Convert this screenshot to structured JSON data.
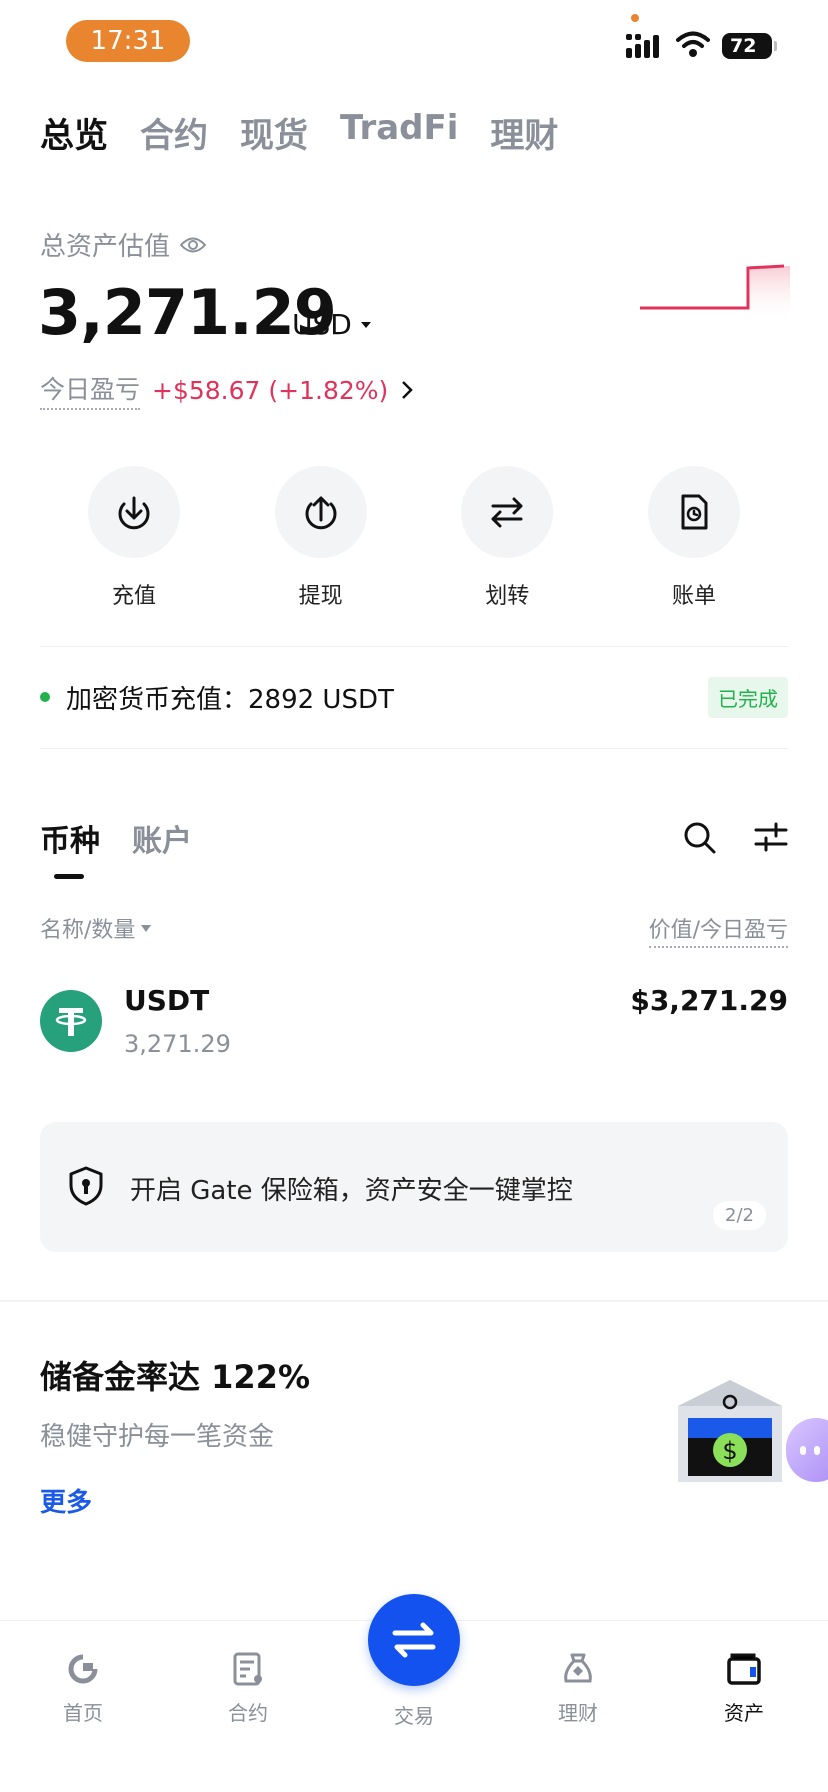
{
  "status_bar": {
    "time": "17:31",
    "battery": "72"
  },
  "top_tabs": [
    {
      "label": "总览",
      "active": true
    },
    {
      "label": "合约",
      "active": false
    },
    {
      "label": "现货",
      "active": false
    },
    {
      "label": "TradFi",
      "active": false
    },
    {
      "label": "理财",
      "active": false
    }
  ],
  "summary": {
    "label": "总资产估值",
    "value": "3,271.29",
    "currency": "USD",
    "pnl_label": "今日盈亏",
    "pnl_value": "+$58.67 (+1.82%)"
  },
  "actions": [
    {
      "label": "充值",
      "icon": "deposit-icon"
    },
    {
      "label": "提现",
      "icon": "withdraw-icon"
    },
    {
      "label": "划转",
      "icon": "transfer-icon"
    },
    {
      "label": "账单",
      "icon": "bill-icon"
    }
  ],
  "notice": {
    "text": "加密货币充值：2892 USDT",
    "badge": "已完成"
  },
  "asset_tabs": [
    {
      "label": "币种",
      "active": true
    },
    {
      "label": "账户",
      "active": false
    }
  ],
  "columns": {
    "left": "名称/数量",
    "right": "价值/今日盈亏"
  },
  "coins": [
    {
      "name": "USDT",
      "amount": "3,271.29",
      "value": "$3,271.29"
    }
  ],
  "promo": {
    "text": "开启 Gate 保险箱，资产安全一键掌控",
    "page": "2/2"
  },
  "reserve": {
    "title": "储备金率达 122%",
    "subtitle": "稳健守护每一笔资金",
    "more": "更多"
  },
  "bottom_nav": [
    {
      "label": "首页",
      "icon": "home-icon"
    },
    {
      "label": "合约",
      "icon": "futures-icon"
    },
    {
      "label": "交易",
      "icon": "trade-icon"
    },
    {
      "label": "理财",
      "icon": "earn-icon"
    },
    {
      "label": "资产",
      "icon": "assets-icon",
      "active": true
    }
  ],
  "colors": {
    "accent": "#1452f0",
    "profit": "#e0335c",
    "success": "#22b14c",
    "usdt": "#26a17b"
  }
}
